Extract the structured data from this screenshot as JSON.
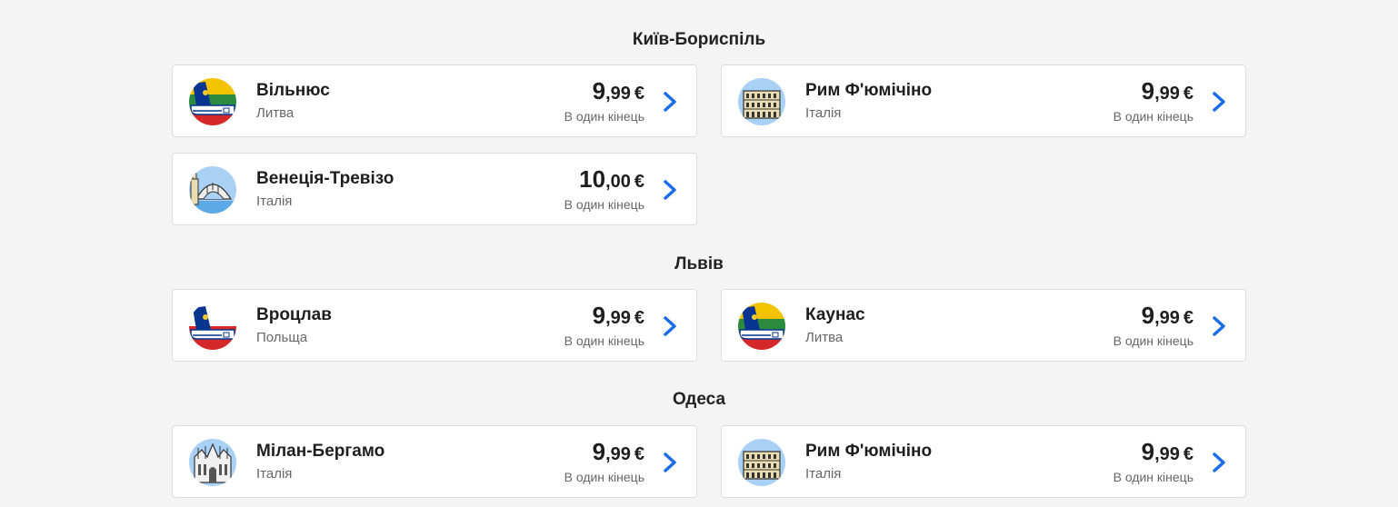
{
  "sections": [
    {
      "title": "Київ-Бориспіль",
      "cards": [
        {
          "city": "Вільнюс",
          "country": "Литва",
          "price_int": "9",
          "price_dec": ",99",
          "currency": "€",
          "note": "В один кінець",
          "icon": "ryanair-tail-lithuania-icon"
        },
        {
          "city": "Рим Ф'юмічіно",
          "country": "Італія",
          "price_int": "9",
          "price_dec": ",99",
          "currency": "€",
          "note": "В один кінець",
          "icon": "colosseum-icon"
        },
        {
          "city": "Венеція-Тревізо",
          "country": "Італія",
          "price_int": "10",
          "price_dec": ",00",
          "currency": "€",
          "note": "В один кінець",
          "icon": "venice-bridge-icon"
        }
      ]
    },
    {
      "title": "Львів",
      "cards": [
        {
          "city": "Вроцлав",
          "country": "Польща",
          "price_int": "9",
          "price_dec": ",99",
          "currency": "€",
          "note": "В один кінець",
          "icon": "ryanair-tail-poland-icon"
        },
        {
          "city": "Каунас",
          "country": "Литва",
          "price_int": "9",
          "price_dec": ",99",
          "currency": "€",
          "note": "В один кінець",
          "icon": "ryanair-tail-lithuania-icon"
        }
      ]
    },
    {
      "title": "Одеса",
      "cards": [
        {
          "city": "Мілан-Бергамо",
          "country": "Італія",
          "price_int": "9",
          "price_dec": ",99",
          "currency": "€",
          "note": "В один кінець",
          "icon": "milan-cathedral-icon"
        },
        {
          "city": "Рим Ф'юмічіно",
          "country": "Італія",
          "price_int": "9",
          "price_dec": ",99",
          "currency": "€",
          "note": "В один кінець",
          "icon": "colosseum-icon"
        }
      ]
    }
  ],
  "colors": {
    "chevron": "#1a6ce8",
    "navy": "#073590",
    "ryanair_yellow": "#f1c933"
  }
}
